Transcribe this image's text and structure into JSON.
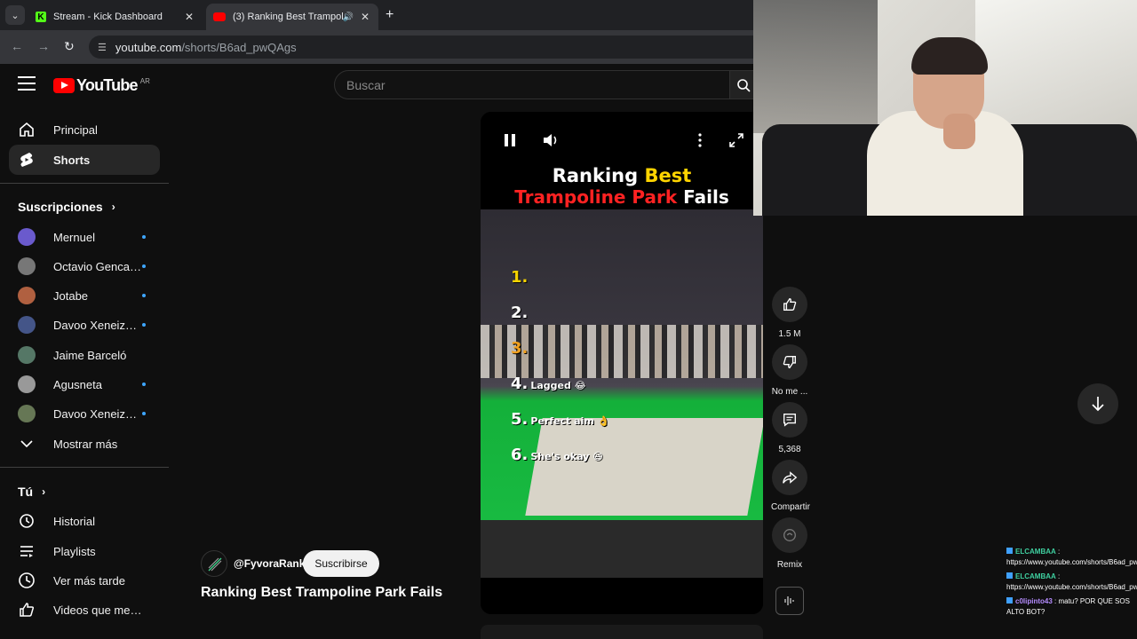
{
  "browser": {
    "tabs": [
      {
        "title": "Stream - Kick Dashboard",
        "active": false
      },
      {
        "title": "(3) Ranking Best Trampoline Park Fails",
        "active": true
      }
    ],
    "url_host": "youtube.com",
    "url_path": "/shorts/B6ad_pwQAgs"
  },
  "header": {
    "logo_text": "YouTube",
    "country_code": "AR",
    "search_placeholder": "Buscar"
  },
  "sidebar": {
    "main": [
      {
        "label": "Principal",
        "icon": "home-icon"
      },
      {
        "label": "Shorts",
        "icon": "shorts-icon",
        "active": true
      }
    ],
    "subscriptions_title": "Suscripciones",
    "subscriptions": [
      {
        "label": "Mernuel",
        "color": "#6a5acd"
      },
      {
        "label": "Octavio Gencarelli",
        "color": "#777777"
      },
      {
        "label": "Jotabe",
        "color": "#b06040"
      },
      {
        "label": "Davoo Xeneize T...",
        "color": "#445588"
      },
      {
        "label": "Jaime Barceló",
        "color": "#557766"
      },
      {
        "label": "Agusneta",
        "color": "#999999"
      },
      {
        "label": "Davoo Xeneize P...",
        "color": "#667755"
      }
    ],
    "show_more": "Mostrar más",
    "you_title": "Tú",
    "you_items": [
      {
        "label": "Historial",
        "icon": "history-icon"
      },
      {
        "label": "Playlists",
        "icon": "playlist-icon"
      },
      {
        "label": "Ver más tarde",
        "icon": "clock-icon"
      },
      {
        "label": "Videos que me gus...",
        "icon": "thumbs-up-icon"
      }
    ]
  },
  "short": {
    "title_line1_a": "Ranking ",
    "title_line1_b": "Best",
    "title_line2_a": "Trampoline Park ",
    "title_line2_b": "Fails",
    "ranks": [
      {
        "n": "1.",
        "caption": ""
      },
      {
        "n": "2.",
        "caption": ""
      },
      {
        "n": "3.",
        "caption": ""
      },
      {
        "n": "4.",
        "caption": "Lagged 😂"
      },
      {
        "n": "5.",
        "caption": "Perfect aim 👌"
      },
      {
        "n": "6.",
        "caption": "She's okay 😆"
      }
    ],
    "channel": "@FyvoraRank",
    "subscribe": "Suscribirse",
    "video_title": "Ranking Best Trampoline Park Fails"
  },
  "actions": {
    "like": "1.5 M",
    "dislike": "No me ...",
    "comments": "5,368",
    "share": "Compartir",
    "remix": "Remix"
  },
  "chat": [
    {
      "user": "ELCAMBAA",
      "text": "https://www.youtube.com/shorts/B6ad_pwQAgs"
    },
    {
      "user": "ELCAMBAA",
      "text": "https://www.youtube.com/shorts/B6ad_pwQAgs"
    },
    {
      "user": "c0lipinto43",
      "text": "matu? POR QUE SOS ALTO BOT?"
    }
  ]
}
